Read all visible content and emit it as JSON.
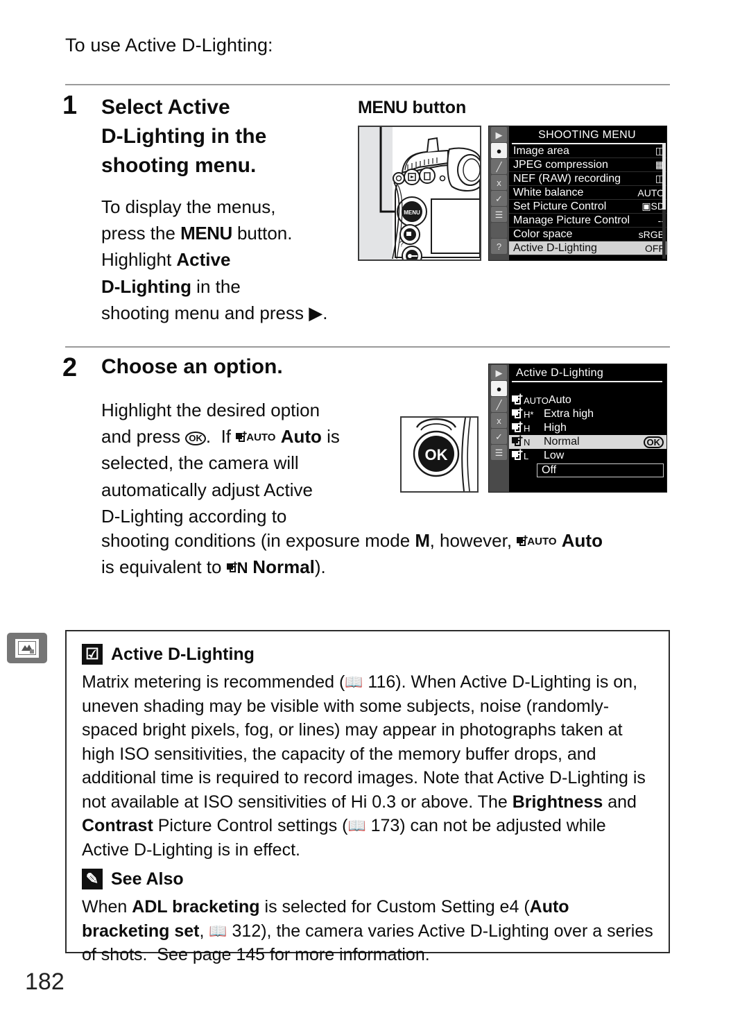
{
  "intro": "To use Active D-Lighting:",
  "steps": [
    {
      "number": "1",
      "heading_html": "Select <b>Active D-Lighting</b> in the shooting menu.",
      "heading_plain": "Select Active D-Lighting in the shooting menu.",
      "body_plain": "To display the menus, press the MENU button. Highlight Active D-Lighting in the shooting menu and press ▶."
    },
    {
      "number": "2",
      "heading_plain": "Choose an option.",
      "body_plain": "Highlight the desired option and press OK.  If AUTO Auto is selected, the camera will automatically adjust Active D-Lighting according to",
      "body_plain_wide": "shooting conditions (in exposure mode M, however, AUTO Auto is equivalent to N Normal)."
    }
  ],
  "menu_button_caption": "MENU button",
  "illustrations": {
    "camera_label": "camera-back-illustration",
    "ok_button_text": "OK"
  },
  "lcd_shooting": {
    "title": "SHOOTING MENU",
    "rail_icons": [
      "playback-icon",
      "shooting-menu-icon",
      "custom-settings-icon",
      "setup-menu-icon",
      "retouch-icon",
      "my-menu-icon",
      "blank",
      "help-icon"
    ],
    "rail_active_index": 1,
    "rows": [
      {
        "label": "Image area",
        "value": "ᴴ",
        "icon": "image-area-icon",
        "selected": false
      },
      {
        "label": "JPEG compression",
        "value": "",
        "icon": "jpeg-compression-icon",
        "selected": false
      },
      {
        "label": "NEF (RAW) recording",
        "value": "",
        "icon": "nef-recording-icon",
        "selected": false
      },
      {
        "label": "White balance",
        "value": "AUTO",
        "icon": "",
        "selected": false
      },
      {
        "label": "Set Picture Control",
        "value": "SD",
        "icon": "picture-control-icon",
        "selected": false
      },
      {
        "label": "Manage Picture Control",
        "value": "--",
        "icon": "",
        "selected": false
      },
      {
        "label": "Color space",
        "value": "sRGB",
        "icon": "",
        "selected": false
      },
      {
        "label": "Active D-Lighting",
        "value": "OFF",
        "icon": "",
        "selected": true
      }
    ]
  },
  "lcd_adl": {
    "title": "Active D-Lighting",
    "rail_icons": [
      "playback-icon",
      "shooting-menu-icon",
      "custom-settings-icon",
      "setup-menu-icon",
      "retouch-icon",
      "my-menu-icon"
    ],
    "rail_active_index": 1,
    "options": [
      {
        "tag": "AUTO",
        "label": "Auto",
        "selected": false,
        "ok": ""
      },
      {
        "tag": "H*",
        "label": "Extra high",
        "selected": false,
        "ok": ""
      },
      {
        "tag": "H",
        "label": "High",
        "selected": false,
        "ok": ""
      },
      {
        "tag": "N",
        "label": "Normal",
        "selected": true,
        "ok": "OK"
      },
      {
        "tag": "L",
        "label": "Low",
        "selected": false,
        "ok": ""
      }
    ],
    "off_label": "Off"
  },
  "notes": [
    {
      "badge": "☑",
      "badge_name": "caution-icon",
      "title": "Active D-Lighting",
      "body": "Matrix metering is recommended (📖 116). When Active D-Lighting is on, uneven shading may be visible with some subjects, noise (randomly-spaced bright pixels, fog, or lines) may appear in photographs taken at high ISO sensitivities, the capacity of the memory buffer drops, and additional time is required to record images. Note that Active D-Lighting is not available at ISO sensitivities of Hi 0.3 or above. The Brightness and Contrast Picture Control settings (📖 173) can not be adjusted while Active D-Lighting is in effect."
    },
    {
      "badge": "✎",
      "badge_name": "pencil-icon",
      "title": "See Also",
      "body": "When ADL bracketing is selected for Custom Setting e4 (Auto bracketing set, 📖 312), the camera varies Active D-Lighting over a series of shots.  See page 145 for more information."
    }
  ],
  "margin_tab": "retouch-tab-icon",
  "page_number": "182"
}
